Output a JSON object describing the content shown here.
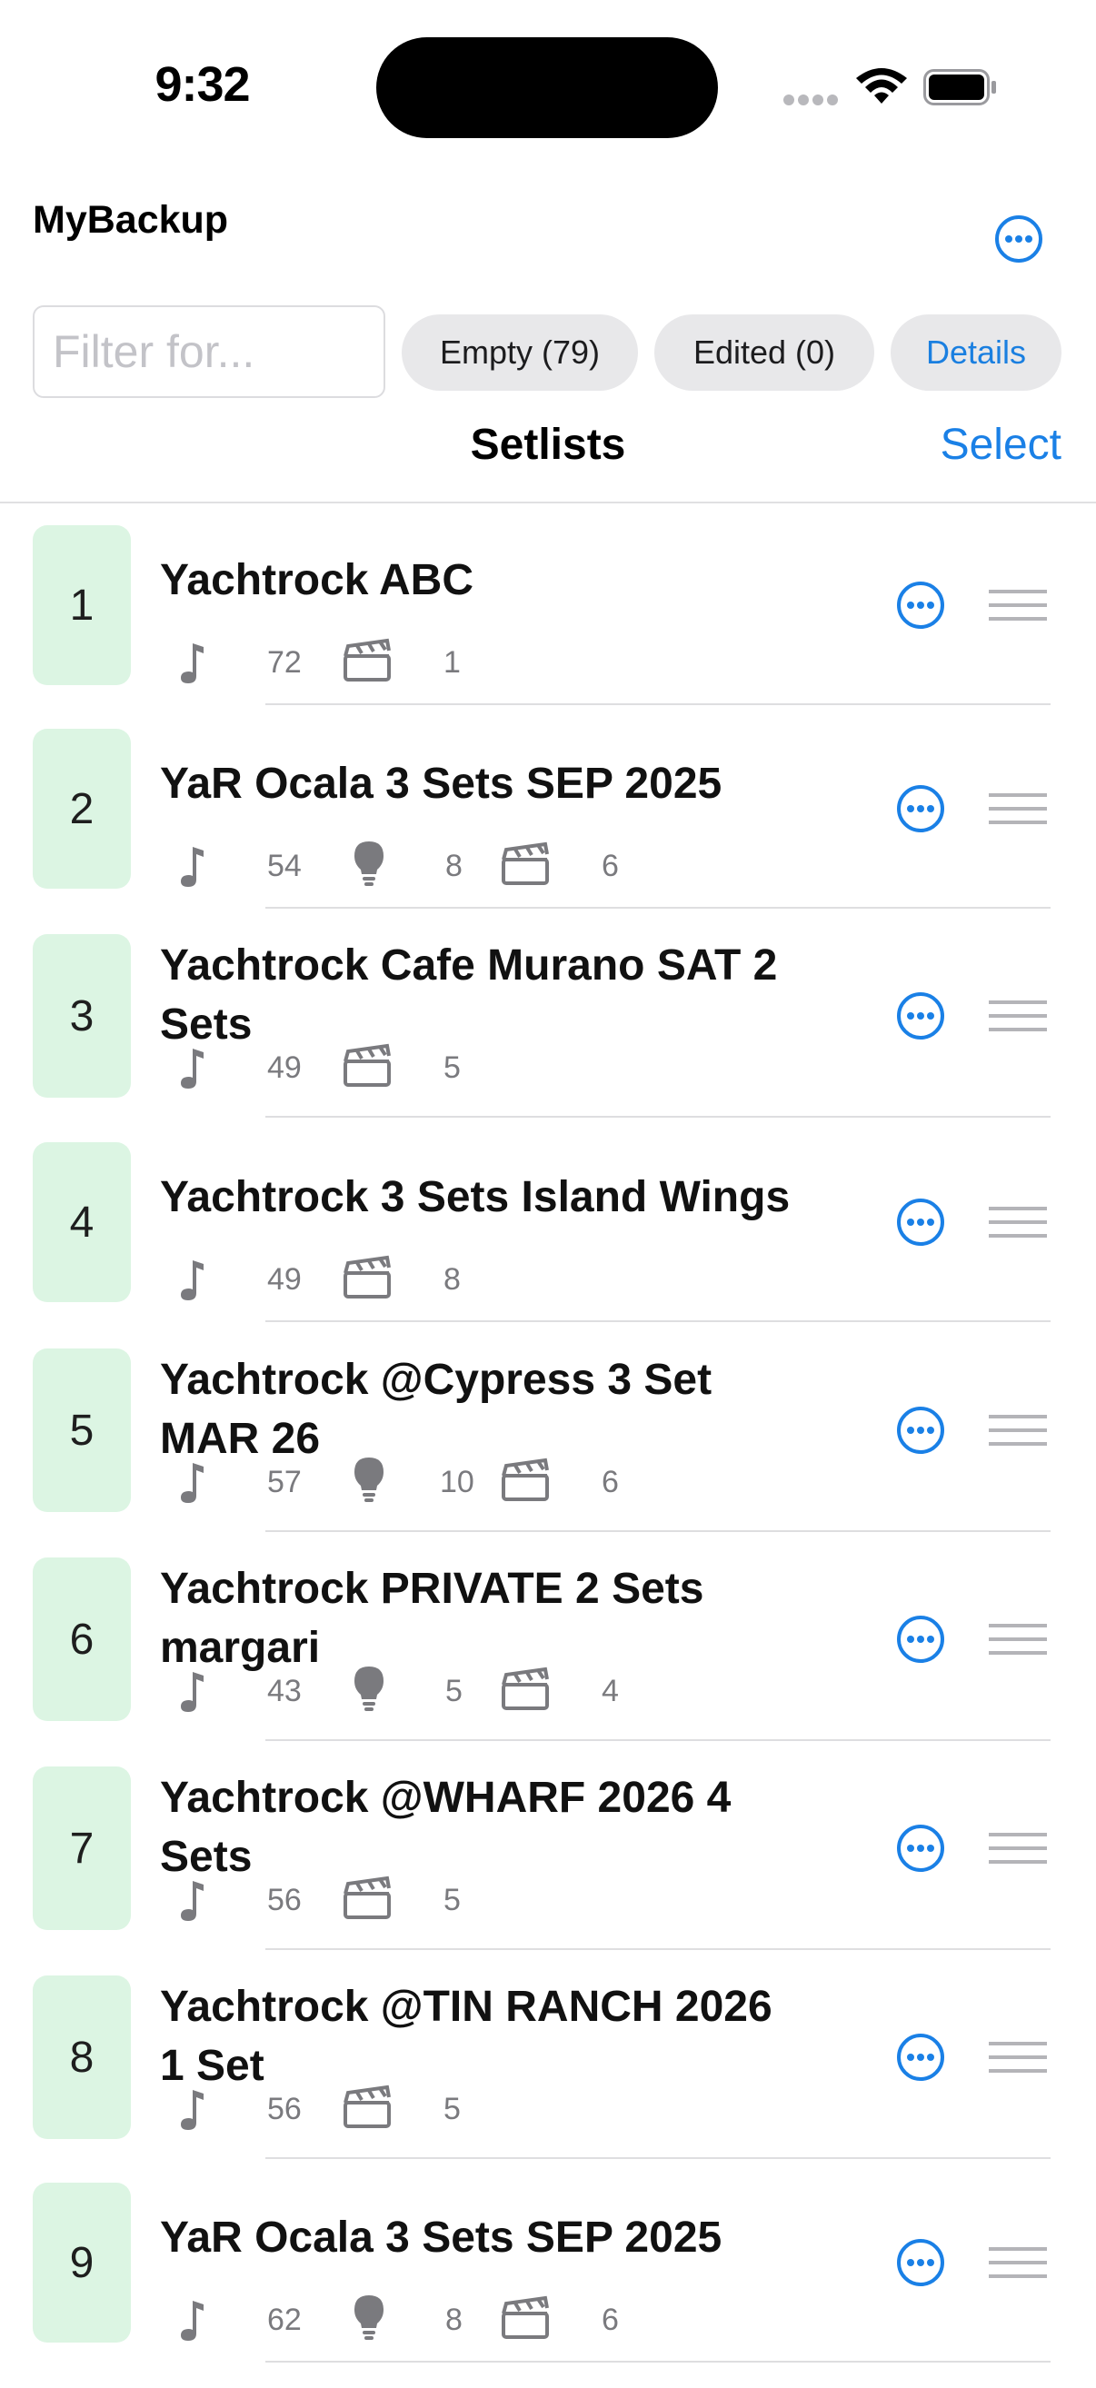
{
  "status": {
    "time": "9:32"
  },
  "header": {
    "title": "MyBackup",
    "more_icon": "ellipsis-circle-icon"
  },
  "filter": {
    "placeholder": "Filter for...",
    "value": "",
    "empty_label": "Empty (79)",
    "edited_label": "Edited (0)",
    "details_label": "Details"
  },
  "nav": {
    "title": "Setlists",
    "select_label": "Select"
  },
  "colors": {
    "accent": "#1a80e6",
    "badge_bg": "#dcf5e3",
    "pill_bg": "#e8e8ea"
  },
  "setlists": [
    {
      "number": "1",
      "title": "Yachtrock ABC",
      "songs": "72",
      "ideas": null,
      "videos": "1"
    },
    {
      "number": "2",
      "title": "YaR Ocala 3 Sets SEP 2025",
      "songs": "54",
      "ideas": "8",
      "videos": "6"
    },
    {
      "number": "3",
      "title": "Yachtrock Cafe Murano SAT 2 Sets",
      "songs": "49",
      "ideas": null,
      "videos": "5"
    },
    {
      "number": "4",
      "title": "Yachtrock 3 Sets Island Wings",
      "songs": "49",
      "ideas": null,
      "videos": "8"
    },
    {
      "number": "5",
      "title": "Yachtrock @Cypress 3 Set MAR 26",
      "songs": "57",
      "ideas": "10",
      "videos": "6"
    },
    {
      "number": "6",
      "title": "Yachtrock PRIVATE 2 Sets margari",
      "songs": "43",
      "ideas": "5",
      "videos": "4"
    },
    {
      "number": "7",
      "title": "Yachtrock @WHARF 2026 4 Sets",
      "songs": "56",
      "ideas": null,
      "videos": "5"
    },
    {
      "number": "8",
      "title": "Yachtrock @TIN RANCH 2026 1 Set",
      "songs": "56",
      "ideas": null,
      "videos": "5"
    },
    {
      "number": "9",
      "title": "YaR Ocala 3 Sets SEP 2025",
      "songs": "62",
      "ideas": "8",
      "videos": "6"
    }
  ]
}
